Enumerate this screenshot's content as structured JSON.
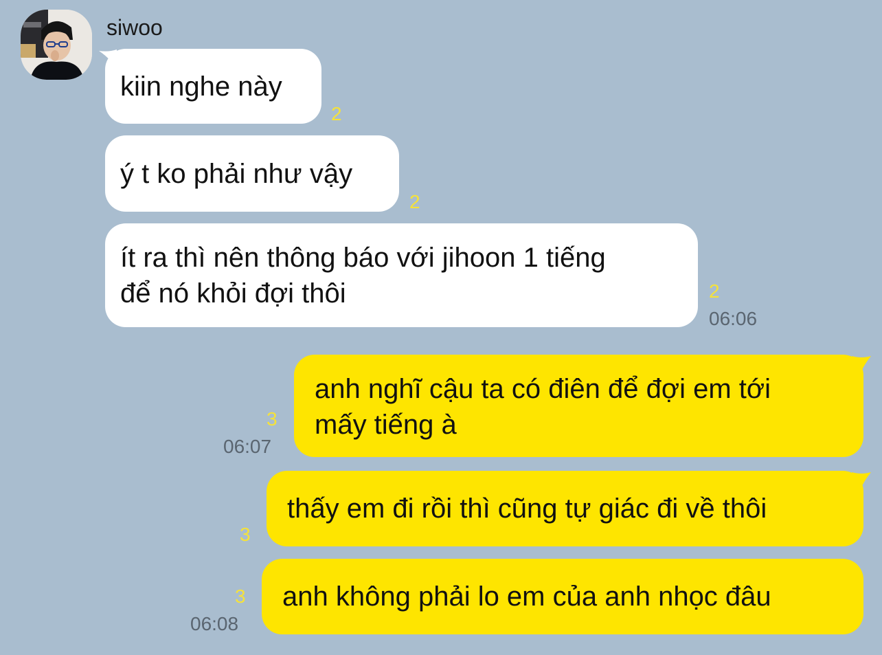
{
  "chat": {
    "contact": {
      "name": "siwoo",
      "avatar_icon": "profile-photo"
    },
    "messages": [
      {
        "direction": "incoming",
        "text": "kiin nghe này",
        "unread": "2",
        "time": ""
      },
      {
        "direction": "incoming",
        "text": "ý t ko phải như vậy",
        "unread": "2",
        "time": ""
      },
      {
        "direction": "incoming",
        "text_line1": "ít ra thì nên thông báo với jihoon 1 tiếng",
        "text_line2": "để nó khỏi đợi thôi",
        "unread": "2",
        "time": "06:06"
      },
      {
        "direction": "outgoing",
        "text_line1": "anh nghĩ cậu ta có điên để đợi em tới",
        "text_line2": "mấy tiếng à",
        "unread": "3",
        "time": "06:07"
      },
      {
        "direction": "outgoing",
        "text": "thấy em đi rồi thì cũng tự giác đi về thôi",
        "unread": "3",
        "time": ""
      },
      {
        "direction": "outgoing",
        "text": "anh không phải lo em của anh nhọc đâu",
        "unread": "3",
        "time": "06:08"
      }
    ]
  },
  "colors": {
    "background": "#a9bdcf",
    "incoming_bubble": "#ffffff",
    "outgoing_bubble": "#fee500",
    "unread_count": "#f5e23a",
    "timestamp": "#5a6570"
  }
}
